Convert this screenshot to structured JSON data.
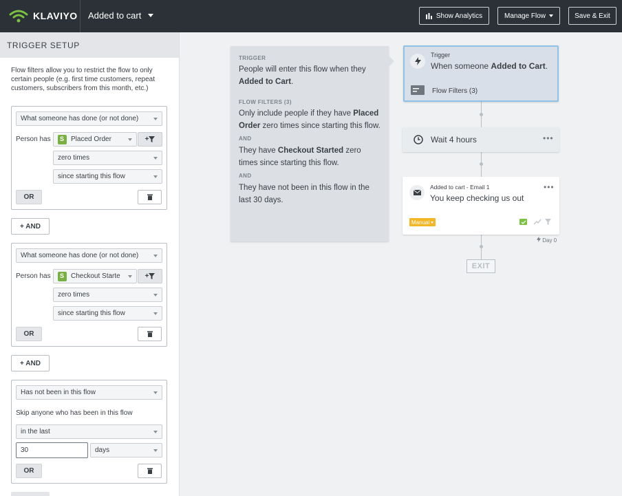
{
  "header": {
    "brand": "KLAVIYO",
    "flow_title": "Added to cart",
    "buttons": {
      "analytics": "Show Analytics",
      "manage": "Manage Flow",
      "save": "Save & Exit"
    }
  },
  "left_panel": {
    "title": "TRIGGER SETUP",
    "description": "Flow filters allow you to restrict the flow to only certain people (e.g. first time customers, repeat customers, subscribers from this month, etc.)",
    "filters": [
      {
        "type": "What someone has done (or not done)",
        "person_has_label": "Person has",
        "metric": "Placed Order",
        "frequency": "zero times",
        "timeframe": "since starting this flow",
        "or_label": "OR"
      },
      {
        "type": "What someone has done (or not done)",
        "person_has_label": "Person has",
        "metric": "Checkout Starte",
        "frequency": "zero times",
        "timeframe": "since starting this flow",
        "or_label": "OR"
      },
      {
        "type": "Has not been in this flow",
        "skip_label": "Skip anyone who has been in this flow",
        "range": "in the last",
        "amount": "30",
        "unit": "days",
        "or_label": "OR"
      }
    ],
    "and_label": "+ AND",
    "filter_add_label": "+"
  },
  "info_card": {
    "trigger_heading": "TRIGGER",
    "trigger_text_pre": "People will enter this flow when they ",
    "trigger_text_bold": "Added to Cart",
    "trigger_text_post": ".",
    "filters_heading": "FLOW FILTERS (3)",
    "f1_pre": "Only include people if they have ",
    "f1_bold": "Placed Order",
    "f1_post": " zero times since starting this flow.",
    "and1": "AND",
    "f2_pre": "They have ",
    "f2_bold": "Checkout Started",
    "f2_post": " zero times since starting this flow.",
    "and2": "AND",
    "f3": "They have not been in this flow in the last 30 days."
  },
  "canvas": {
    "trigger_label": "Trigger",
    "trigger_text_pre": "When someone ",
    "trigger_text_bold": "Added to Cart",
    "trigger_text_post": ".",
    "flow_filters": "Flow Filters (3)",
    "wait_label": "Wait 4 hours",
    "email_label": "Added to cart - Email 1",
    "email_subject": "You keep checking us out",
    "manual_badge": "Manual",
    "day_label": "Day 0",
    "exit_label": "EXIT",
    "dots": "•••"
  },
  "colors": {
    "topbar": "#2b3137",
    "logo_green": "#7cc242",
    "trigger_border": "#8fc2e6",
    "manual_badge": "#f3b624"
  }
}
